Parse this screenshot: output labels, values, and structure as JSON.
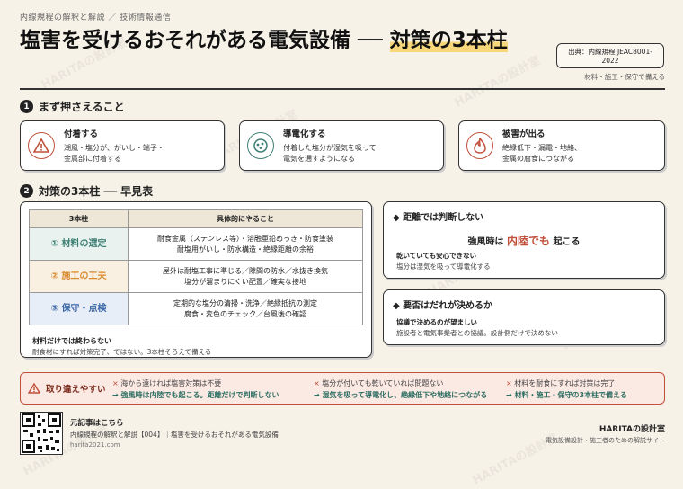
{
  "header": {
    "kicker": "内線規程の解釈と解説 ／ 技術情報通信",
    "title_main": "塩害を受けるおそれがある電気設備 ── ",
    "title_highlight": "対策の3本柱",
    "source_line1": "出典：内線規程 JEAC8001-",
    "source_line2": "2022",
    "source_sub": "材料・施工・保守で備える"
  },
  "section1": {
    "num": "1",
    "title": "まず押さえること",
    "cards": [
      {
        "icon": "warning-triangle-icon",
        "color": "#c0503a",
        "title": "付着する",
        "line1": "潮風・塩分が、がいし・端子・",
        "line2": "金属部に付着する"
      },
      {
        "icon": "conduction-circle-icon",
        "color": "#3d7e73",
        "title": "導電化する",
        "line1": "付着した塩分が湿気を吸って",
        "line2": "電気を通すようになる"
      },
      {
        "icon": "flame-icon",
        "color": "#c0503a",
        "title": "被害が出る",
        "line1": "絶縁低下・漏電・地絡、",
        "line2": "金属の腐食につながる"
      }
    ]
  },
  "section2": {
    "num": "2",
    "title": "対策の3本柱 ── 早見表",
    "table": {
      "headers": [
        "3本柱",
        "具体的にやること"
      ],
      "rows": [
        {
          "name": "① 材料の選定",
          "line1": "耐食金属（ステンレス等）・溶融亜鉛めっき・防食塗装",
          "line2": "耐塩用がいし・防水構造・絶縁距離の余裕"
        },
        {
          "name": "② 施工の工夫",
          "line1": "屋外は耐塩工事に準じる／隙間の防水／水抜き換気",
          "line2": "塩分が溜まりにくい配置／確実な接地"
        },
        {
          "name": "③ 保守・点検",
          "line1": "定期的な塩分の清掃・洗浄／絶縁抵抗の測定",
          "line2": "腐食・変色のチェック／台風後の確認"
        }
      ]
    },
    "note_title": "材料だけでは終わらない",
    "note_text": "耐食材にすれば対策完了、ではない。3本柱そろえて備える"
  },
  "side": {
    "box1": {
      "title": "距離では判断しない",
      "main_pre": "強風時は",
      "main_em": "内陸でも",
      "main_post": "起こる",
      "sub_title": "乾いていても安心できない",
      "sub_text": "塩分は湿気を吸って導電化する"
    },
    "box2": {
      "title": "要否はだれが決めるか",
      "sub_title": "協議で決めるのが望ましい",
      "sub_text": "施設者と電気事業者との協議。設計側だけで決めない"
    }
  },
  "mistakes": {
    "label": "取り違えやすい",
    "items": [
      {
        "wrong": "海から遠ければ塩害対策は不要",
        "right": "→ 強風時は内陸でも起こる。距離だけで判断しない"
      },
      {
        "wrong": "塩分が付いても乾いていれば問題ない",
        "right": "→ 湿気を吸って導電化し、絶縁低下や地絡につながる"
      },
      {
        "wrong": "材料を耐食にすれば対策は完了",
        "right": "→ 材料・施工・保守の3本柱で備える"
      }
    ]
  },
  "footer": {
    "qr_title": "元記事はこちら",
    "qr_line1": "内線規程の解釈と解説【004】｜塩害を受けるおそれがある電気設備",
    "qr_line2": "harita2021.com",
    "brand": "HARITAの設計室",
    "brand_sub": "電気設備設計・施工者のための解説サイト"
  },
  "watermark": "HARITAの設計室",
  "colors": {
    "accent_green": "#3d7e73",
    "accent_orange": "#d88a2e",
    "accent_blue": "#3a66a8",
    "warning_red": "#c0503a",
    "highlight_yellow": "#f7d77a"
  }
}
